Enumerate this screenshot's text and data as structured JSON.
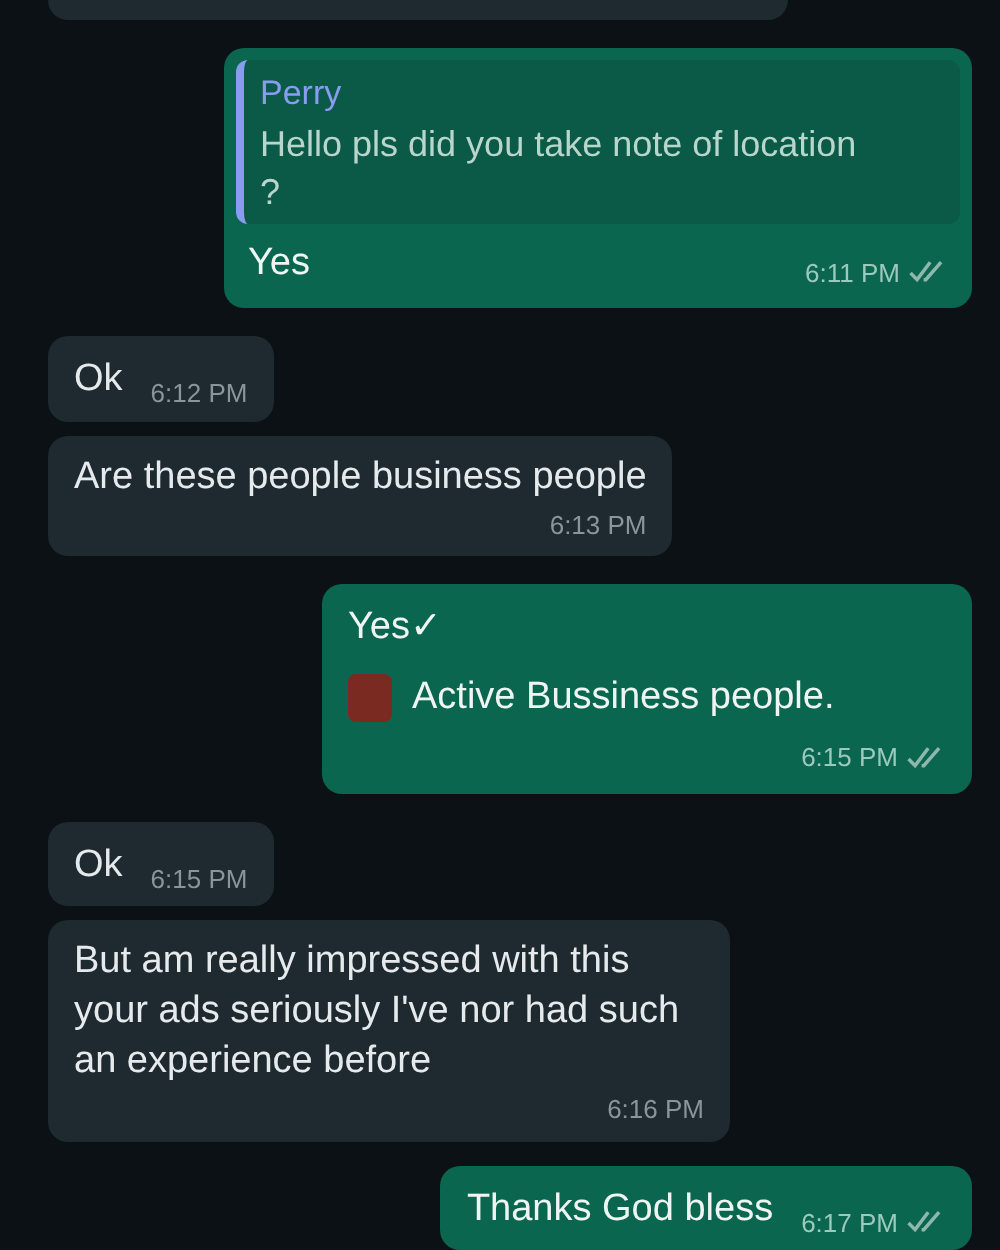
{
  "messages": [
    {
      "outgoing": false,
      "kind": "cut"
    },
    {
      "outgoing": true,
      "kind": "reply",
      "quote": {
        "author": "Perry",
        "text": "Hello pls did you take note of location ?"
      },
      "text": "Yes",
      "time": "6:11 PM",
      "read": false
    },
    {
      "outgoing": false,
      "kind": "short",
      "text": "Ok",
      "time": "6:12 PM"
    },
    {
      "outgoing": false,
      "kind": "text",
      "text": "Are these people business people",
      "time": "6:13 PM"
    },
    {
      "outgoing": true,
      "kind": "lines",
      "text": "Yes✓",
      "line2": "Active Bussiness people.",
      "time": "6:15 PM",
      "read": false
    },
    {
      "outgoing": false,
      "kind": "short",
      "text": "Ok",
      "time": "6:15 PM"
    },
    {
      "outgoing": false,
      "kind": "text",
      "text": "But am really impressed with this your ads seriously I've nor had such an experience before",
      "time": "6:16 PM"
    },
    {
      "outgoing": true,
      "kind": "short",
      "text": "Thanks God bless",
      "time": "6:17 PM",
      "read": false
    }
  ]
}
